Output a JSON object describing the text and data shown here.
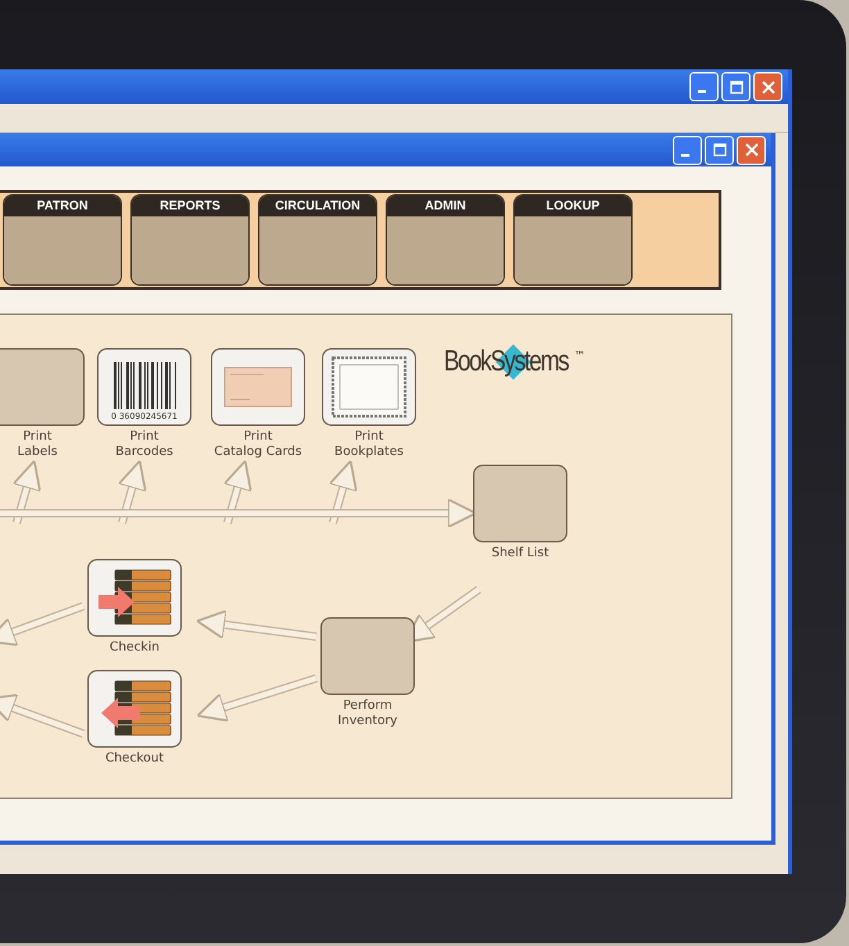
{
  "toolbar": {
    "buttons": [
      {
        "label": "PATRON"
      },
      {
        "label": "REPORTS"
      },
      {
        "label": "CIRCULATION"
      },
      {
        "label": "ADMIN"
      },
      {
        "label": "LOOKUP"
      }
    ]
  },
  "diagram": {
    "logo": {
      "name": "Book",
      "name_2": "Systems",
      "mark": "™"
    },
    "nodes": [
      {
        "label": "Print\nLabels",
        "kind": "photo"
      },
      {
        "label": "Print\nBarcodes",
        "kind": "barcode",
        "code": "0 36090245671"
      },
      {
        "label": "Print\nCatalog Cards",
        "kind": "card"
      },
      {
        "label": "Print\nBookplates",
        "kind": "bookplate"
      },
      {
        "label": "Shelf List",
        "kind": "photo"
      },
      {
        "label": "Checkin",
        "kind": "checkin"
      },
      {
        "label": "Checkout",
        "kind": "checkout"
      },
      {
        "label": "Perform\nInventory",
        "kind": "photo"
      }
    ]
  }
}
